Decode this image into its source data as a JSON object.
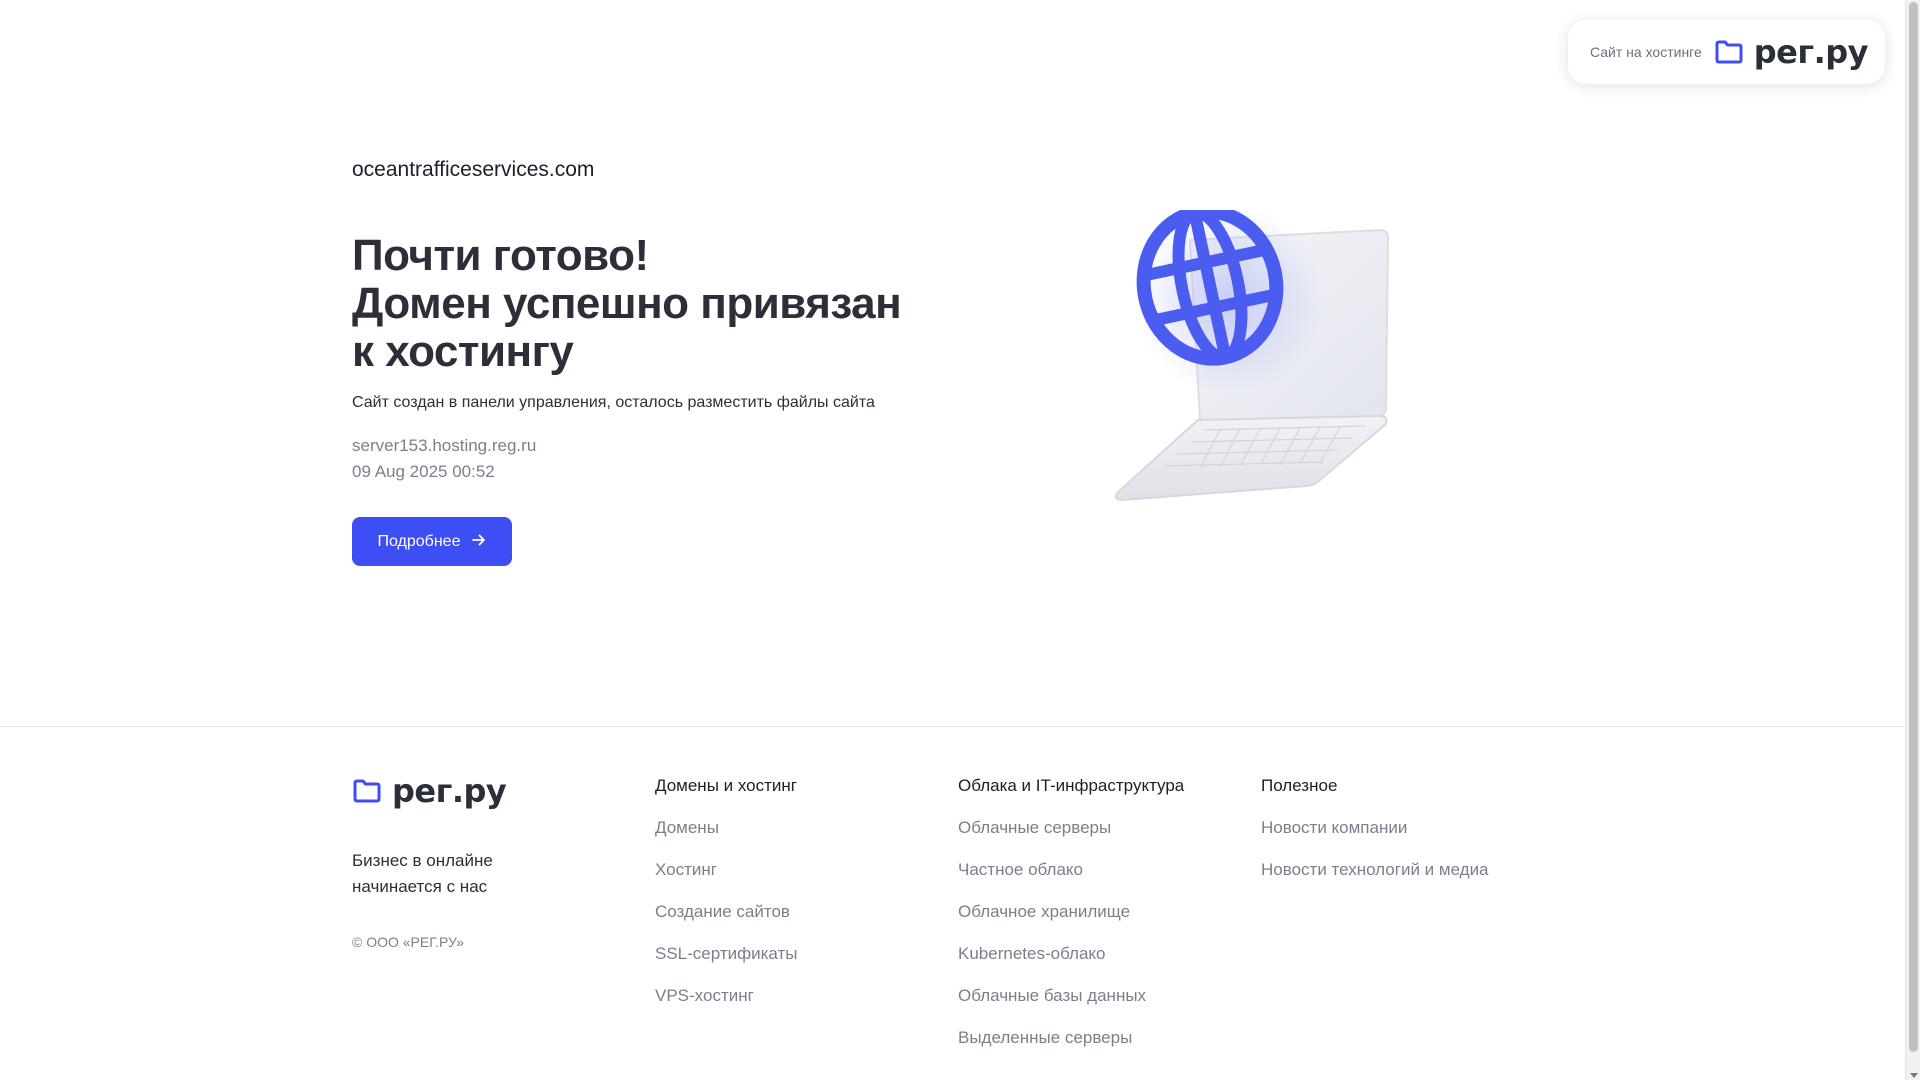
{
  "badge": {
    "text": "Сайт на хостинге",
    "logo_text": "рег.ру"
  },
  "hero": {
    "domain": "oceantrafficeservices.com",
    "headline": [
      "Почти готово!",
      "Домен успешно привязан",
      "к хостингу"
    ],
    "subtitle": "Сайт создан в панели управления, осталось разместить файлы сайта",
    "server": "server153.hosting.reg.ru",
    "date": "09 Aug 2025 00:52",
    "button_label": "Подробнее",
    "illustration": "laptop-globe-illustration"
  },
  "footer": {
    "logo_text": "рег.ру",
    "slogan": "Бизнес в онлайне начинается с нас",
    "copyright": "© ООО «РЕГ.РУ»",
    "columns": [
      {
        "title": "Домены и хостинг",
        "links": [
          "Домены",
          "Хостинг",
          "Создание сайтов",
          "SSL-сертификаты",
          "VPS-хостинг"
        ]
      },
      {
        "title": "Облака и IT-инфраструктура",
        "links": [
          "Облачные серверы",
          "Частное облако",
          "Облачное хранилище",
          "Kubernetes-облако",
          "Облачные базы данных",
          "Выделенные серверы"
        ]
      },
      {
        "title": "Полезное",
        "links": [
          "Новости компании",
          "Новости технологий и медиа"
        ]
      }
    ]
  },
  "colors": {
    "accent": "#3d4ef5",
    "text": "#2c2f3a",
    "muted": "#7b7f8c"
  },
  "icons": {
    "logo": "folder-logo-icon",
    "button": "arrow-right-icon"
  }
}
